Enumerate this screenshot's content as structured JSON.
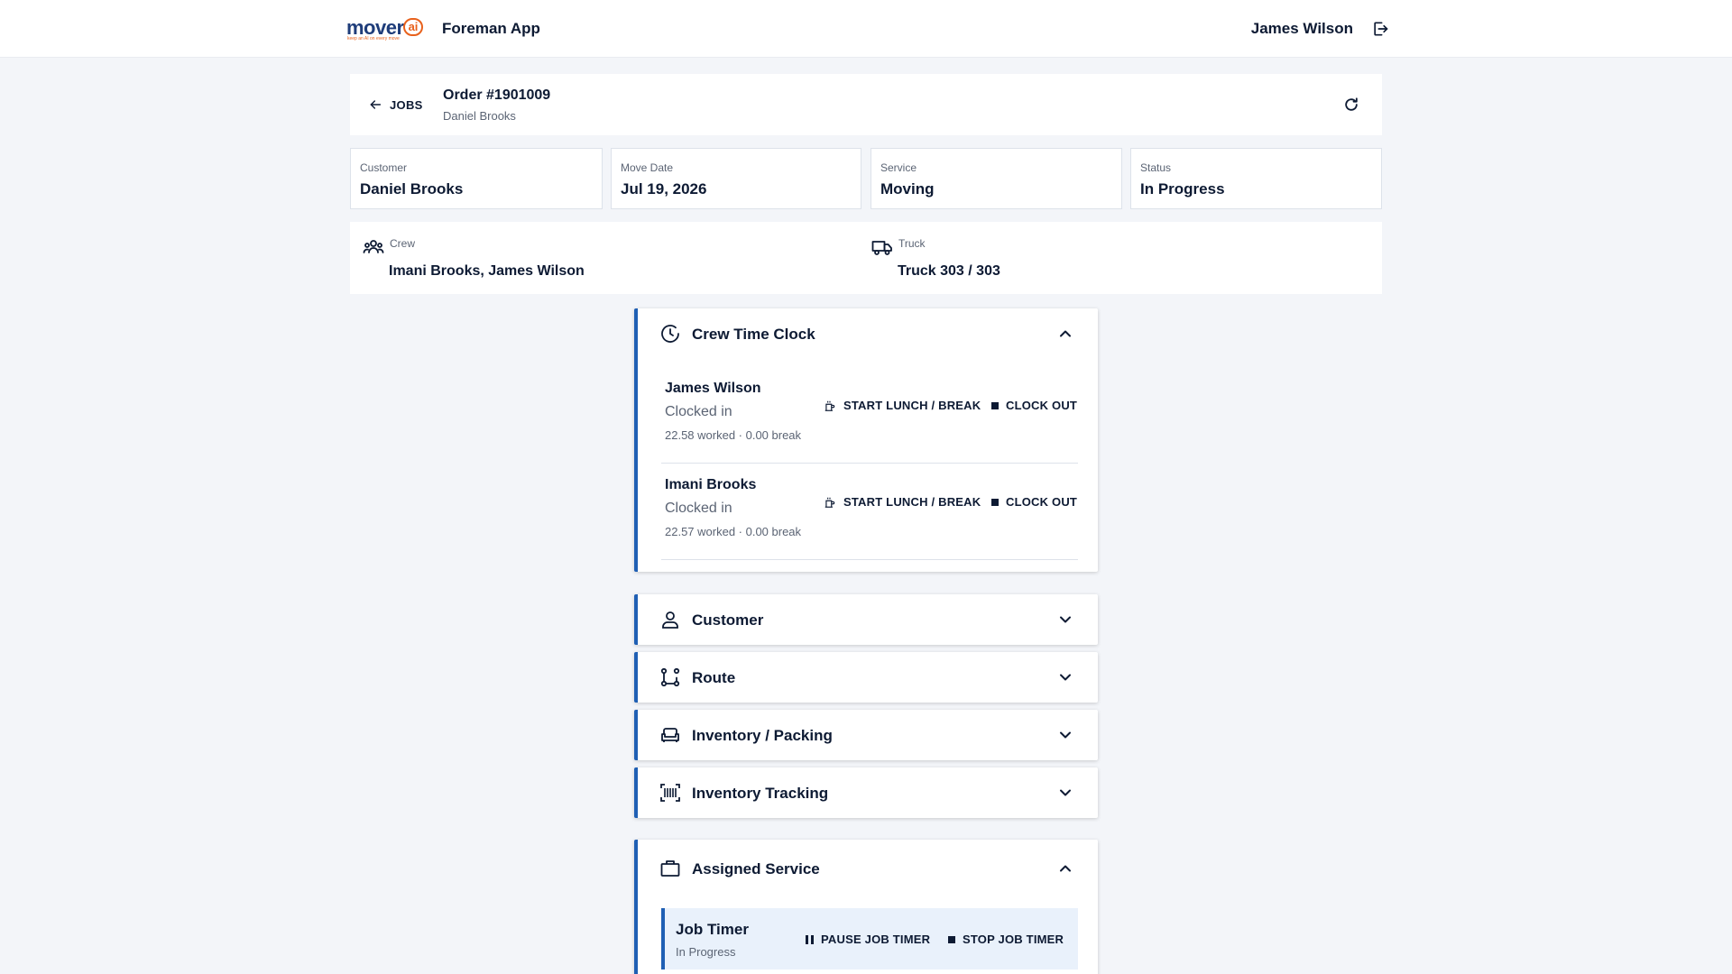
{
  "app": {
    "logo_text": "mover",
    "logo_ai": "ai",
    "logo_tagline": "keep an AI on every move",
    "title": "Foreman App",
    "user_name": "James Wilson"
  },
  "order": {
    "back_label": "JOBS",
    "title": "Order #1901009",
    "subtitle": "Daniel Brooks"
  },
  "tiles": [
    {
      "label": "Customer",
      "value": "Daniel Brooks"
    },
    {
      "label": "Move Date",
      "value": "Jul 19, 2026"
    },
    {
      "label": "Service",
      "value": "Moving"
    },
    {
      "label": "Status",
      "value": "In Progress"
    }
  ],
  "crew_info": {
    "crew_label": "Crew",
    "crew_value": "Imani Brooks, James Wilson",
    "truck_label": "Truck",
    "truck_value": "Truck 303 / 303"
  },
  "time_clock": {
    "title": "Crew Time Clock",
    "start_break_label": "START LUNCH / BREAK",
    "clock_out_label": "CLOCK OUT",
    "members": [
      {
        "name": "James Wilson",
        "status": "Clocked in",
        "worked": "22.58 worked · 0.00 break"
      },
      {
        "name": "Imani Brooks",
        "status": "Clocked in",
        "worked": "22.57 worked · 0.00 break"
      }
    ]
  },
  "sections": [
    {
      "title": "Customer",
      "icon": "person-icon"
    },
    {
      "title": "Route",
      "icon": "route-icon"
    },
    {
      "title": "Inventory / Packing",
      "icon": "sofa-icon"
    },
    {
      "title": "Inventory Tracking",
      "icon": "barcode-icon"
    }
  ],
  "assigned_service": {
    "title": "Assigned Service",
    "job_timer_title": "Job Timer",
    "job_timer_status": "In Progress",
    "pause_label": "PAUSE JOB TIMER",
    "stop_label": "STOP JOB TIMER"
  },
  "colors": {
    "accent": "#1f5fb4",
    "brand_orange": "#e8611c",
    "text_primary": "#0d1a33",
    "text_secondary": "#5b6474",
    "page_bg": "#f3f5f9"
  }
}
